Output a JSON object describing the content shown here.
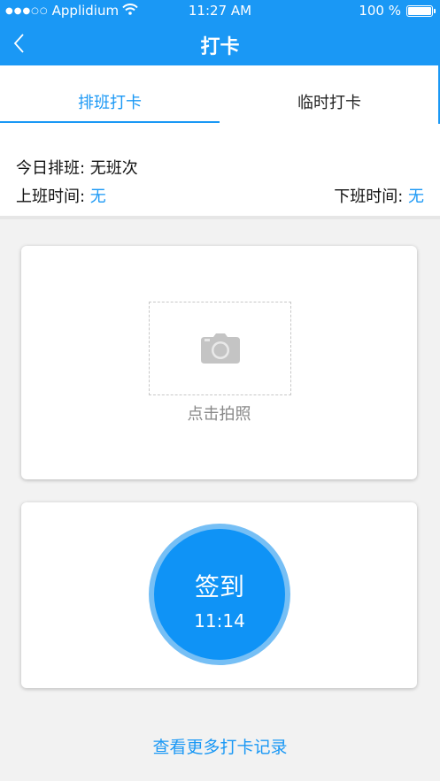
{
  "status_bar": {
    "signal": "●●●○○",
    "carrier": "Applidium",
    "wifi_icon": "wifi-icon",
    "time": "11:27 AM",
    "battery": "100 %"
  },
  "nav": {
    "title": "打卡",
    "back_icon": "chevron-left-icon"
  },
  "tabs": [
    {
      "label": "排班打卡",
      "active": true
    },
    {
      "label": "临时打卡",
      "active": false
    }
  ],
  "schedule": {
    "today_label": "今日排班: ",
    "today_value": "无班次",
    "start_label": "上班时间: ",
    "start_value": "无",
    "end_label": "下班时间: ",
    "end_value": "无"
  },
  "photo": {
    "icon": "camera-icon",
    "label": "点击拍照"
  },
  "checkin": {
    "label": "签到",
    "time": "11:14"
  },
  "more_link": "查看更多打卡记录",
  "colors": {
    "accent": "#1a98f5",
    "button": "#0f93f6",
    "button_ring": "#76bff5"
  }
}
